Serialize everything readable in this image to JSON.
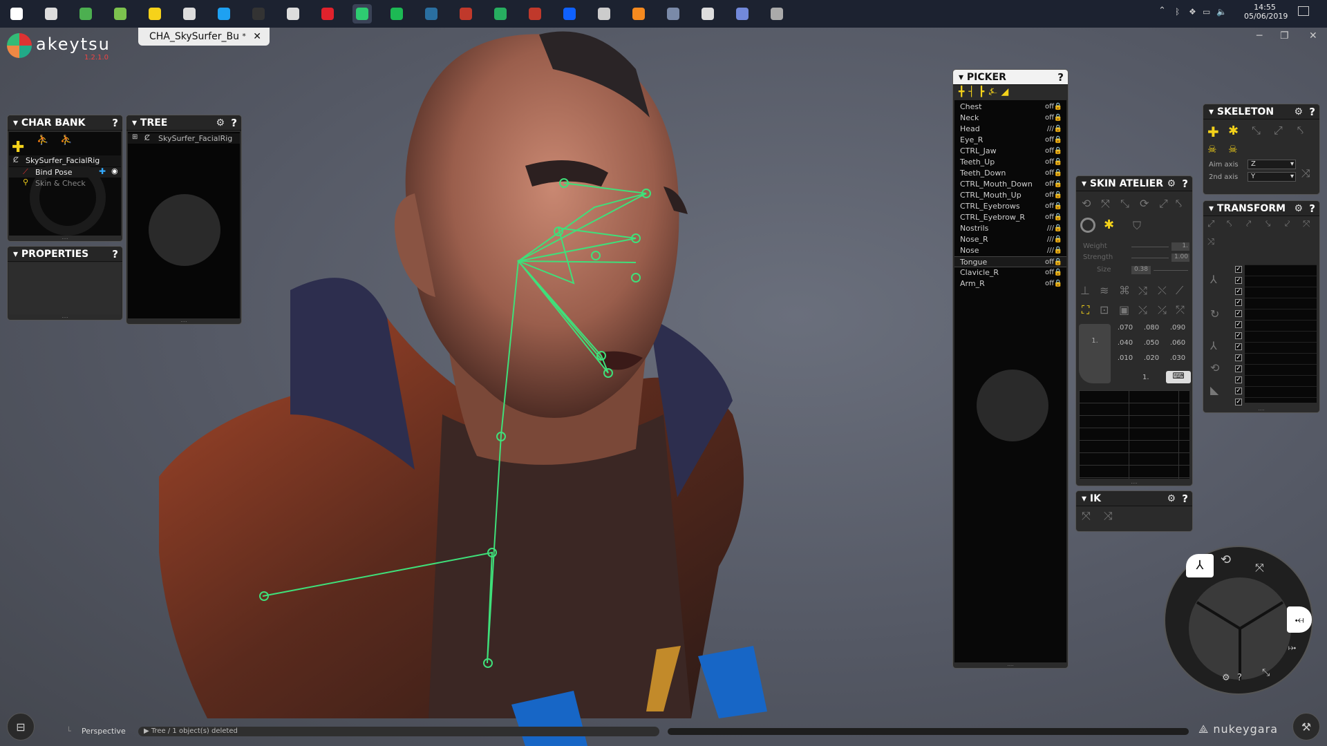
{
  "taskbar": {
    "time": "14:55",
    "date": "05/06/2019",
    "icons": [
      "windows-start",
      "cortana",
      "clover",
      "image-viewer",
      "sticky-notes",
      "notepad",
      "skype",
      "epic-games",
      "unity",
      "opera",
      "browser",
      "spotify",
      "app-m",
      "recorder",
      "browser-2",
      "recorder-2",
      "dropbox",
      "monitor",
      "blender",
      "app-s",
      "settings",
      "discord",
      "app-flag"
    ]
  },
  "app": {
    "name": "akeytsu",
    "version": "1.2.1.0",
    "tab_title": "CHA_SkySurfer_Bu",
    "tab_modified": "*",
    "tab_close": "✕"
  },
  "panels": {
    "charbank": {
      "title": "CHAR BANK",
      "help": "?",
      "rig": "SkySurfer_FacialRig",
      "bind_pose": "Bind Pose",
      "skin_check": "Skin & Check"
    },
    "tree": {
      "title": "TREE",
      "help": "?",
      "item": "SkySurfer_FacialRig"
    },
    "properties": {
      "title": "PROPERTIES",
      "help": "?"
    },
    "picker": {
      "title": "PICKER",
      "help": "?",
      "rows": [
        {
          "name": "Chest",
          "state": "off"
        },
        {
          "name": "Neck",
          "state": "off"
        },
        {
          "name": "Head",
          "state": "///"
        },
        {
          "name": "Eye_R",
          "state": "off"
        },
        {
          "name": "CTRL_Jaw",
          "state": "off"
        },
        {
          "name": "Teeth_Up",
          "state": "off"
        },
        {
          "name": "Teeth_Down",
          "state": "off"
        },
        {
          "name": "CTRL_Mouth_Down",
          "state": "off"
        },
        {
          "name": "CTRL_Mouth_Up",
          "state": "off"
        },
        {
          "name": "CTRL_Eyebrows",
          "state": "off"
        },
        {
          "name": "CTRL_Eyebrow_R",
          "state": "off"
        },
        {
          "name": "Nostrils",
          "state": "///"
        },
        {
          "name": "Nose_R",
          "state": "///"
        },
        {
          "name": "Nose",
          "state": "///"
        },
        {
          "name": "Tongue",
          "state": "off"
        },
        {
          "name": "Clavicle_R",
          "state": "off"
        },
        {
          "name": "Arm_R",
          "state": "off"
        }
      ]
    },
    "skin_atelier": {
      "title": "SKIN ATELIER",
      "help": "?",
      "weight_label": "Weight",
      "weight_value": "1.",
      "strength_label": "Strength",
      "strength_value": "1.00",
      "size_label": "Size",
      "size_value": "0.38",
      "grid_values": [
        ".070",
        ".080",
        ".090",
        ".040",
        ".050",
        ".060",
        ".010",
        ".020",
        ".030"
      ],
      "side_value": "1.",
      "bottom_value": "1."
    },
    "ik": {
      "title": "IK",
      "help": "?"
    },
    "skeleton": {
      "title": "SKELETON",
      "help": "?",
      "aim_label": "Aim axis",
      "aim_value": "Z",
      "second_label": "2nd axis",
      "second_value": "Y"
    },
    "transform": {
      "title": "TRANSFORM",
      "help": "?"
    }
  },
  "viewport": {
    "camera": "Perspective",
    "status": "▶ Tree / 1 object(s) deleted"
  },
  "brand": {
    "name": "nukeygara"
  }
}
